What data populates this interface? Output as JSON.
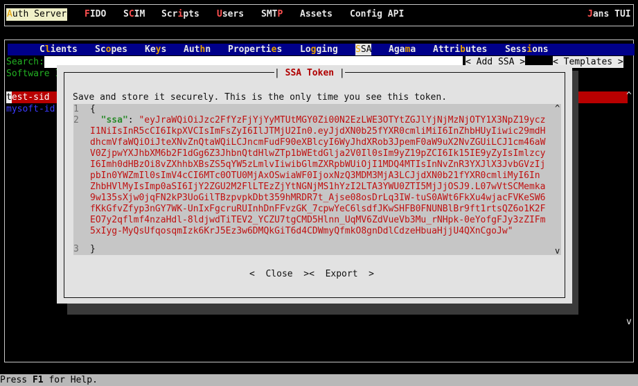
{
  "top_menu": {
    "items": [
      {
        "prefix": "",
        "hot": "A",
        "rest": "uth Server"
      },
      {
        "prefix": "",
        "hot": "F",
        "rest": "IDO"
      },
      {
        "prefix": "S",
        "hot": "C",
        "rest": "IM"
      },
      {
        "prefix": "Scr",
        "hot": "i",
        "rest": "pts"
      },
      {
        "prefix": "",
        "hot": "U",
        "rest": "sers"
      },
      {
        "prefix": "SMT",
        "hot": "P",
        "rest": ""
      },
      {
        "prefix": "Assets",
        "hot": "",
        "rest": ""
      },
      {
        "prefix": "Config API",
        "hot": "",
        "rest": ""
      }
    ],
    "brand": {
      "hot": "J",
      "rest": "ans TUI"
    }
  },
  "tabs": [
    {
      "prefix": "C",
      "hot": "l",
      "rest": "ients"
    },
    {
      "prefix": "Sc",
      "hot": "o",
      "rest": "pes"
    },
    {
      "prefix": "Ke",
      "hot": "y",
      "rest": "s"
    },
    {
      "prefix": "Aut",
      "hot": "h",
      "rest": "n"
    },
    {
      "prefix": "Properti",
      "hot": "e",
      "rest": "s"
    },
    {
      "prefix": "Lo",
      "hot": "g",
      "rest": "ging"
    },
    {
      "prefix": "",
      "hot": "S",
      "rest": "SA"
    },
    {
      "prefix": "Aga",
      "hot": "m",
      "rest": "a"
    },
    {
      "prefix": "Attri",
      "hot": "b",
      "rest": "utes"
    },
    {
      "prefix": "Sess",
      "hot": "i",
      "rest": "ons"
    }
  ],
  "search_label": "Search:",
  "software_label": "Software I",
  "add_ssa": "< Add SSA >",
  "templates": "< Templates >",
  "list": {
    "row1_first": "t",
    "row1_rest": "est-sid",
    "row2": "mysoft-id"
  },
  "scroll_up": "^",
  "scroll_down": "v",
  "dialog": {
    "title_open": "| ",
    "title": "SSA Token",
    "title_close": " |",
    "message": "Save and store it securely. This is the only time you see this token.",
    "line1_num": "1",
    "line1": "{",
    "line2_num": "2",
    "key": "\"ssa\"",
    "colon": ": ",
    "token_lines": [
      "\"eyJraWQiOiJzc2FfYzFjYjYyMTUtMGY0Zi00N2EzLWE3OTYtZGJlYjNjMzNjOTY1X3NpZ19ycz",
      "I1NiIsInR5cCI6IkpXVCIsImFsZyI6IlJTMjU2In0.eyJjdXN0b25fYXR0cmliMiI6InZhbHUyIiwic29mdH",
      "dhcmVfaWQiOiJteXNvZnQtaWQiLCJncmFudF90eXBlcyI6WyJhdXRob3JpemF0aW9uX2NvZGUiLCJ1cm46aW",
      "V0ZjpwYXJhbXM6b2F1dGg6Z3JhbnQtdHlwZTp1bWEtdGlja2V0Il0sIm9yZ19pZCI6Ik15IE9yZyIsImlzcy",
      "I6Imh0dHBzOi8vZXhhbXBsZS5qYW5zLmlvIiwibGlmZXRpbWUiOjI1MDQ4MTIsInNvZnR3YXJlX3JvbGVzIj",
      "pbIn0YWZmIl0sImV4cCI6MTc0OTU0MjAxOSwiaWF0IjoxNzQ3MDM3MjA3LCJjdXN0b21fYXR0cmliMyI6In",
      "ZhbHVlMyIsImp0aSI6IjY2ZGU2M2FlLTEzZjYtNGNjMS1hYzI2LTA3YWU0ZTI5MjJjOSJ9.L07wVtSCMemka",
      "9w135sXjw0jqFN2kP3UoGilTBzpvpkDbt359hMRDR7t_Ajse08osDrLq3IW-tuS0AWt6FkXu4wjacFVKeSW6",
      "fKkGfvZfyp3nGY7WK-UnIxFgcruRUInhDnFFvzGK_7cpwYeC6lsdfJKwSHFB0FNUNBlBr9ft1rtsQZ6o1K2F",
      "EO7y2qflmf4nzaHdl-8ldjwdTiTEV2_YCZU7tgCMD5Hlnn_UqMV6ZdVueVb3Mu_rNHpk-0eYofgFJy3zZIFm",
      "5xIyg-MyQsUfqosqmIzk6KrJ5Ez3w6DMQkGiT6d4CDWmyQfmkO8gnDdlCdzeHbuaHjjU4QXnCgoJw\""
    ],
    "line3_num": "3",
    "line3": "}",
    "close_button": "<  Close  >",
    "export_button": "<  Export  >",
    "editor_scroll_up": "^",
    "editor_scroll_down": "v"
  },
  "status": {
    "prefix": "Press ",
    "key": "F1",
    "suffix": " for Help."
  },
  "colors": {
    "tabbar": "#00008a",
    "selected_row": "#b80000",
    "hotkey": "#e5a000",
    "json_key": "#2a8a2a",
    "json_string": "#c01010"
  }
}
